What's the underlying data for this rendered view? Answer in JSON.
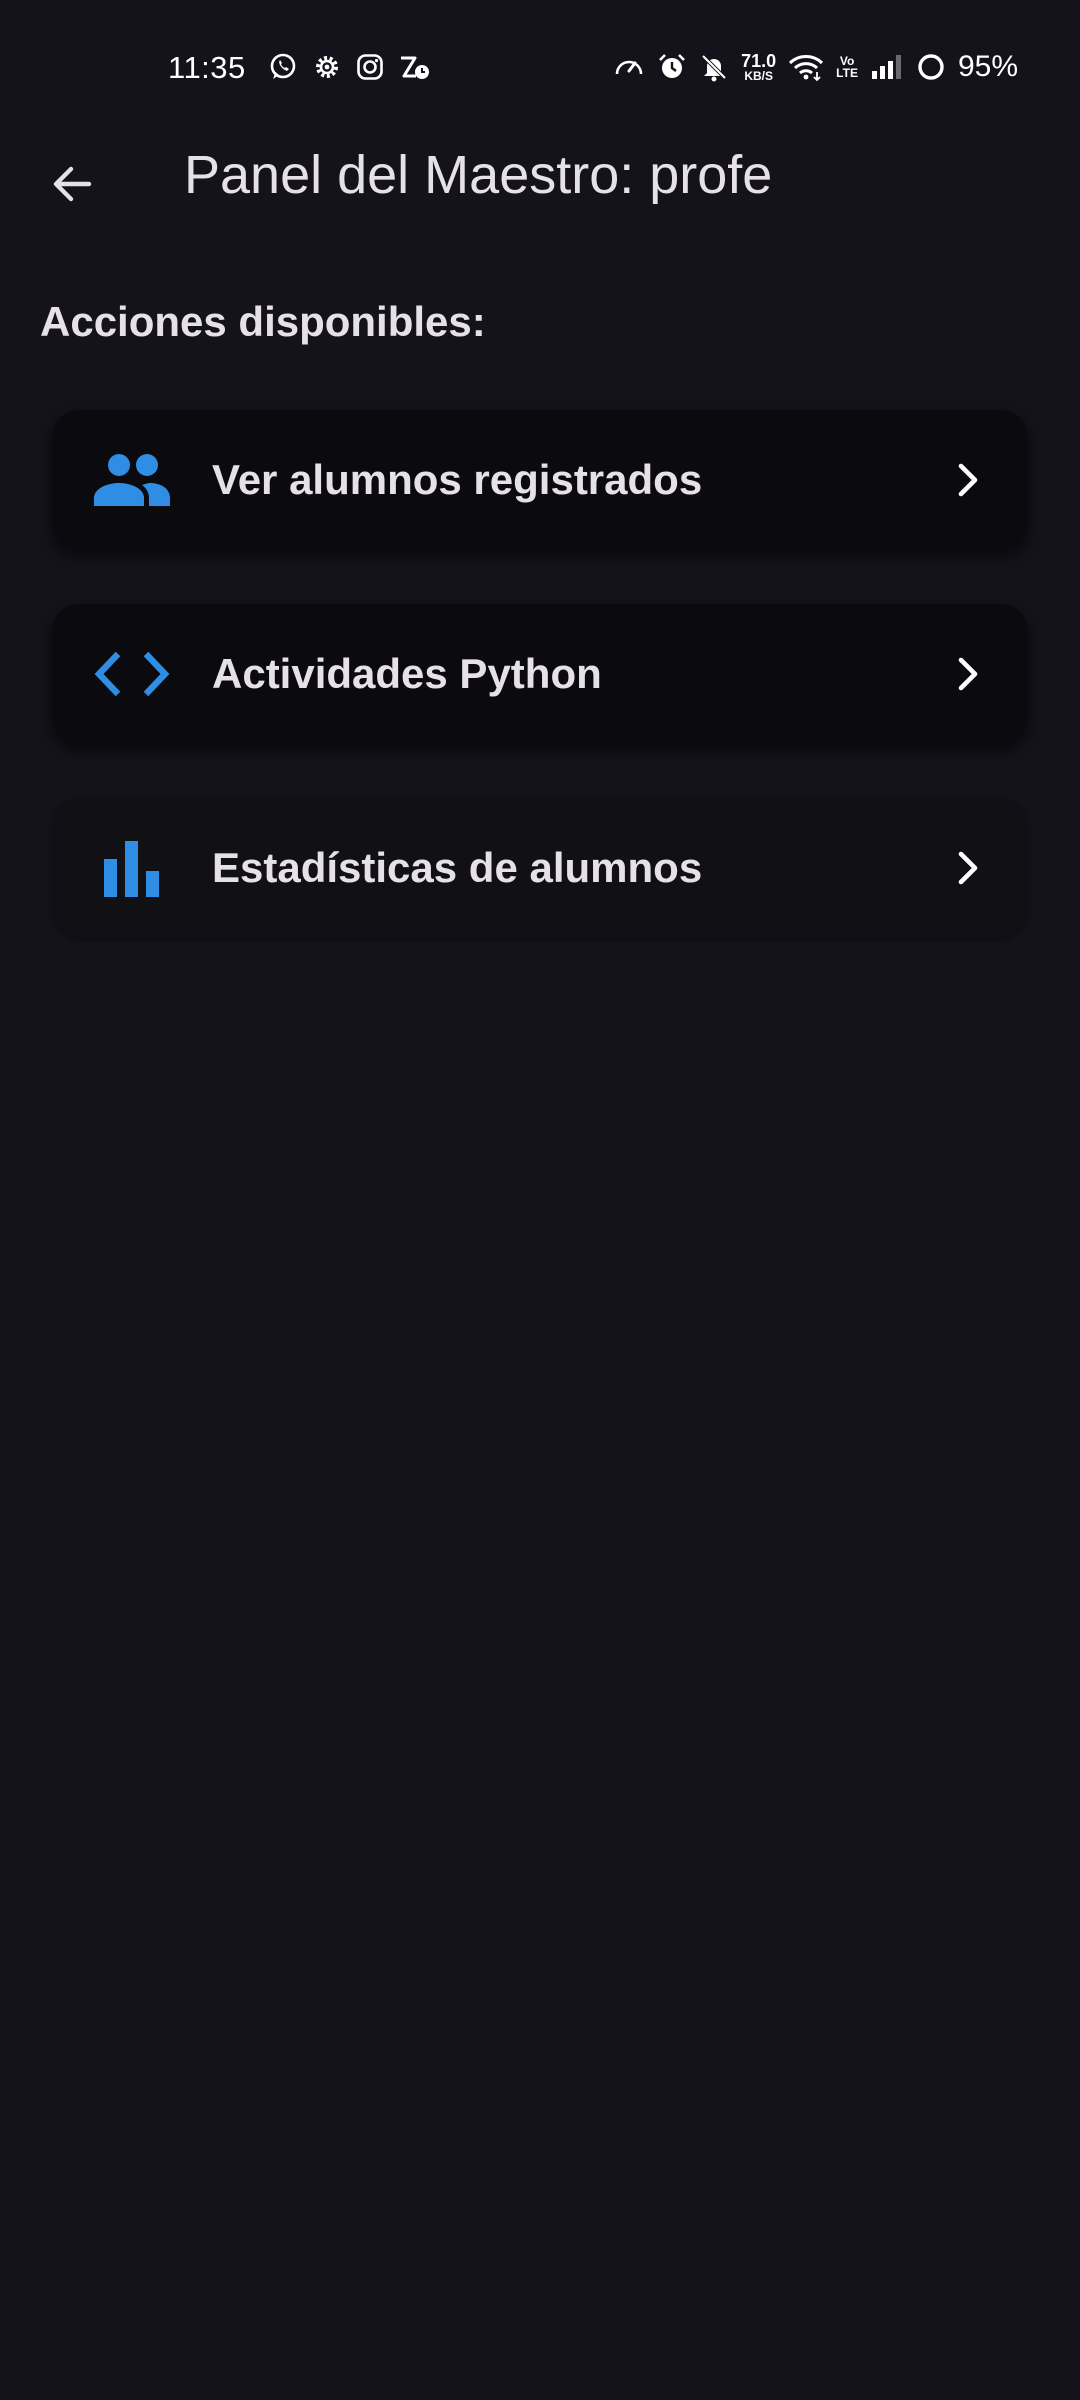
{
  "status_bar": {
    "time": "11:35",
    "left_icons": [
      "whatsapp-icon",
      "settings-gear-icon",
      "instagram-icon",
      "zomato-icon"
    ],
    "speed_value": "71.0",
    "speed_unit": "KB/S",
    "volte_top": "Vo",
    "volte_bottom": "LTE",
    "battery_text": "95%"
  },
  "app_bar": {
    "back_icon": "arrow-back-icon",
    "title": "Panel del Maestro: profe"
  },
  "main": {
    "section_title": "Acciones disponibles:",
    "actions": [
      {
        "icon": "people-icon",
        "label": "Ver alumnos registrados"
      },
      {
        "icon": "code-icon",
        "label": "Actividades Python"
      },
      {
        "icon": "bar-chart-icon",
        "label": "Estadísticas de alumnos"
      }
    ]
  },
  "colors": {
    "background": "#14121a",
    "card": "#0b0a0e",
    "accent": "#2f8de4",
    "text": "#e6e1e9"
  }
}
